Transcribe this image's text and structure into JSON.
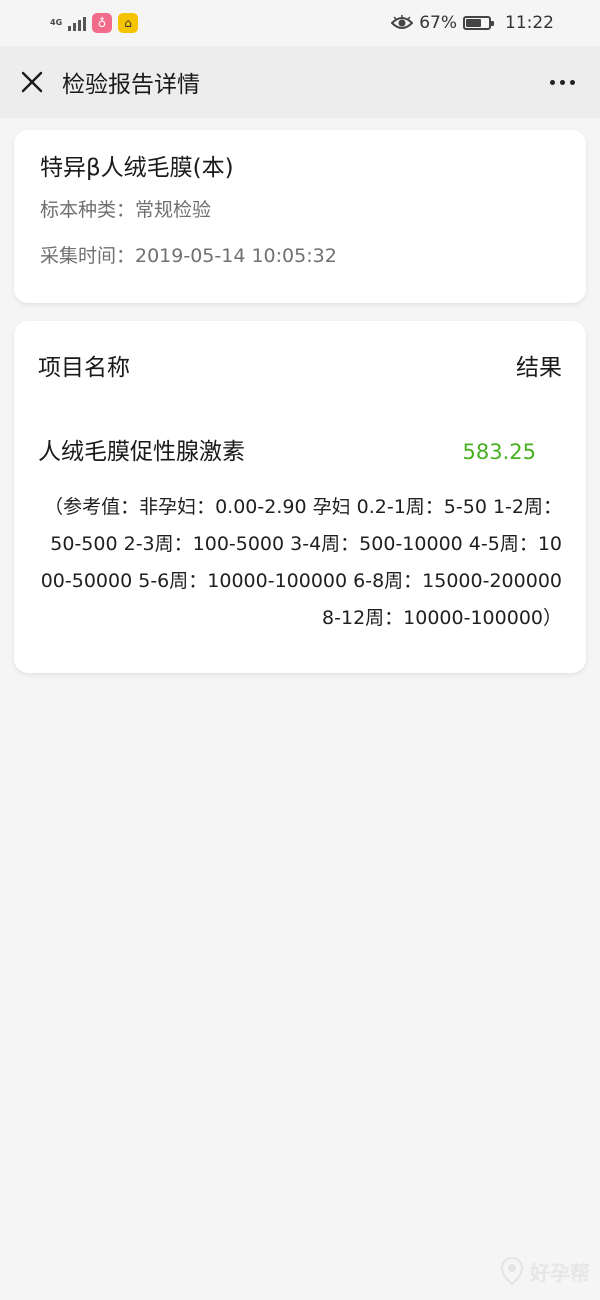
{
  "status_bar": {
    "network": "4G",
    "battery_percent": "67%",
    "battery_level": 0.67,
    "time": "11:22"
  },
  "header": {
    "title": "检验报告详情"
  },
  "report": {
    "title": "特异β人绒毛膜(本)",
    "specimen": "标本种类：常规检验",
    "collected": "采集时间：2019-05-14 10:05:32"
  },
  "results": {
    "col_name": "项目名称",
    "col_result": "结果",
    "items": [
      {
        "name": "人绒毛膜促性腺激素",
        "value": "583.25",
        "reference": "（参考值：非孕妇：0.00-2.90 孕妇 0.2-1周：5-50 1-2周：50-500 2-3周：100-5000 3-4周：500-10000 4-5周：1000-50000 5-6周：10000-100000 6-8周：15000-200000 8-12周：10000-100000）"
      }
    ]
  },
  "colors": {
    "result_value": "#48b021",
    "background": "#f5f5f5"
  },
  "watermark": {
    "text": "好孕帮"
  }
}
